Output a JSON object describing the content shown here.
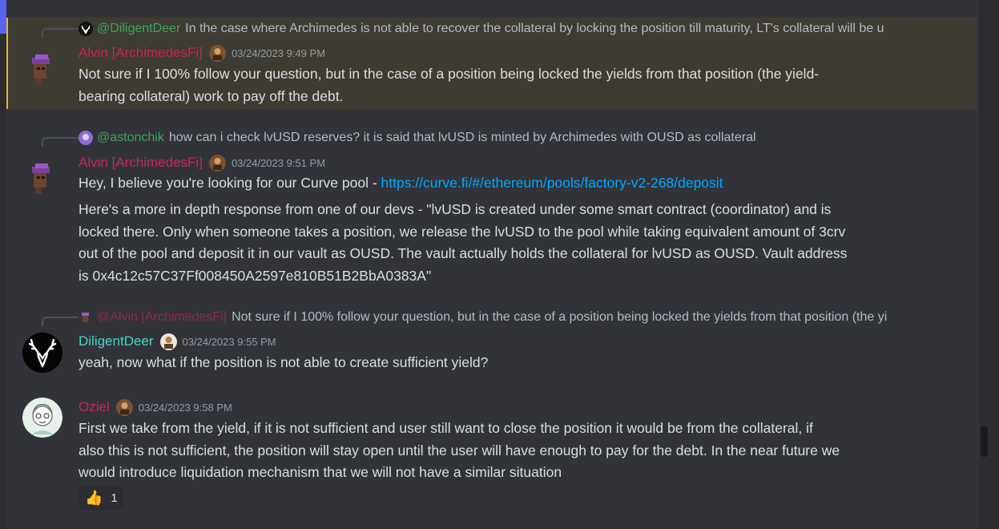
{
  "colors": {
    "background": "#313338",
    "highlight_background": "#3e3b33",
    "highlight_border": "#f0b232",
    "alvin_name": "#c7255b",
    "deer_name": "#44d8c6",
    "oziel_name": "#c7255b",
    "mention": "#3ba55c",
    "link": "#00a8fc",
    "timestamp": "#949ba4"
  },
  "messages": [
    {
      "reply": {
        "user": "@DiligentDeer",
        "text": "In the case where Archimedes is not able to recover the collateral by locking the position till maturity, LT's collateral will be u"
      },
      "author": "Alvin [ArchimedesFi]",
      "timestamp": "03/24/2023 9:49 PM",
      "lines": [
        "Not sure if I 100% follow your question, but in the case of a position being locked the yields from that position (the yield-",
        "bearing collateral) work to pay off the debt."
      ]
    },
    {
      "reply": {
        "user": "@astonchik",
        "text": "how can i check lvUSD reserves? it is said that lvUSD is minted by Archimedes with OUSD as collateral"
      },
      "author": "Alvin [ArchimedesFi]",
      "timestamp": "03/24/2023 9:51 PM",
      "line1_prefix": "Hey, I believe you're looking for our Curve pool - ",
      "line1_link": "https://curve.fi/#/ethereum/pools/factory-v2-268/deposit",
      "lines": [
        "Here's a more in depth response from one of our devs  - \"lvUSD is created under some smart contract (coordinator) and is",
        "locked there. Only when someone takes a position, we release the lvUSD to the pool while taking equivalent amount of 3crv",
        "out of the pool and deposit it in our vault as OUSD. The vault actually holds the collateral for lvUSD as OUSD. Vault address",
        "is 0x4c12c57C37Ff008450A2597e810B51B2BbA0383A\""
      ]
    },
    {
      "reply": {
        "user": "@Alvin [ArchimedesFi]",
        "text": "Not sure if I 100% follow your question, but in the case of a position being locked the yields from that position (the yi"
      },
      "author": "DiligentDeer",
      "timestamp": "03/24/2023 9:55 PM",
      "lines": [
        "yeah, now what if the position is not able to create sufficient yield?"
      ]
    },
    {
      "author": "Oziel",
      "timestamp": "03/24/2023 9:58 PM",
      "lines": [
        "First we take from the yield, if it is not sufficient and user still want to close the position it would be from the collateral, if",
        "also this is not sufficient, the position will stay open until the user will have enough to pay for the debt. In the near future we",
        "would introduce liquidation mechanism that we will not have a similar situation"
      ],
      "reaction": {
        "emoji": "thumbs-up",
        "count": "1"
      }
    }
  ]
}
